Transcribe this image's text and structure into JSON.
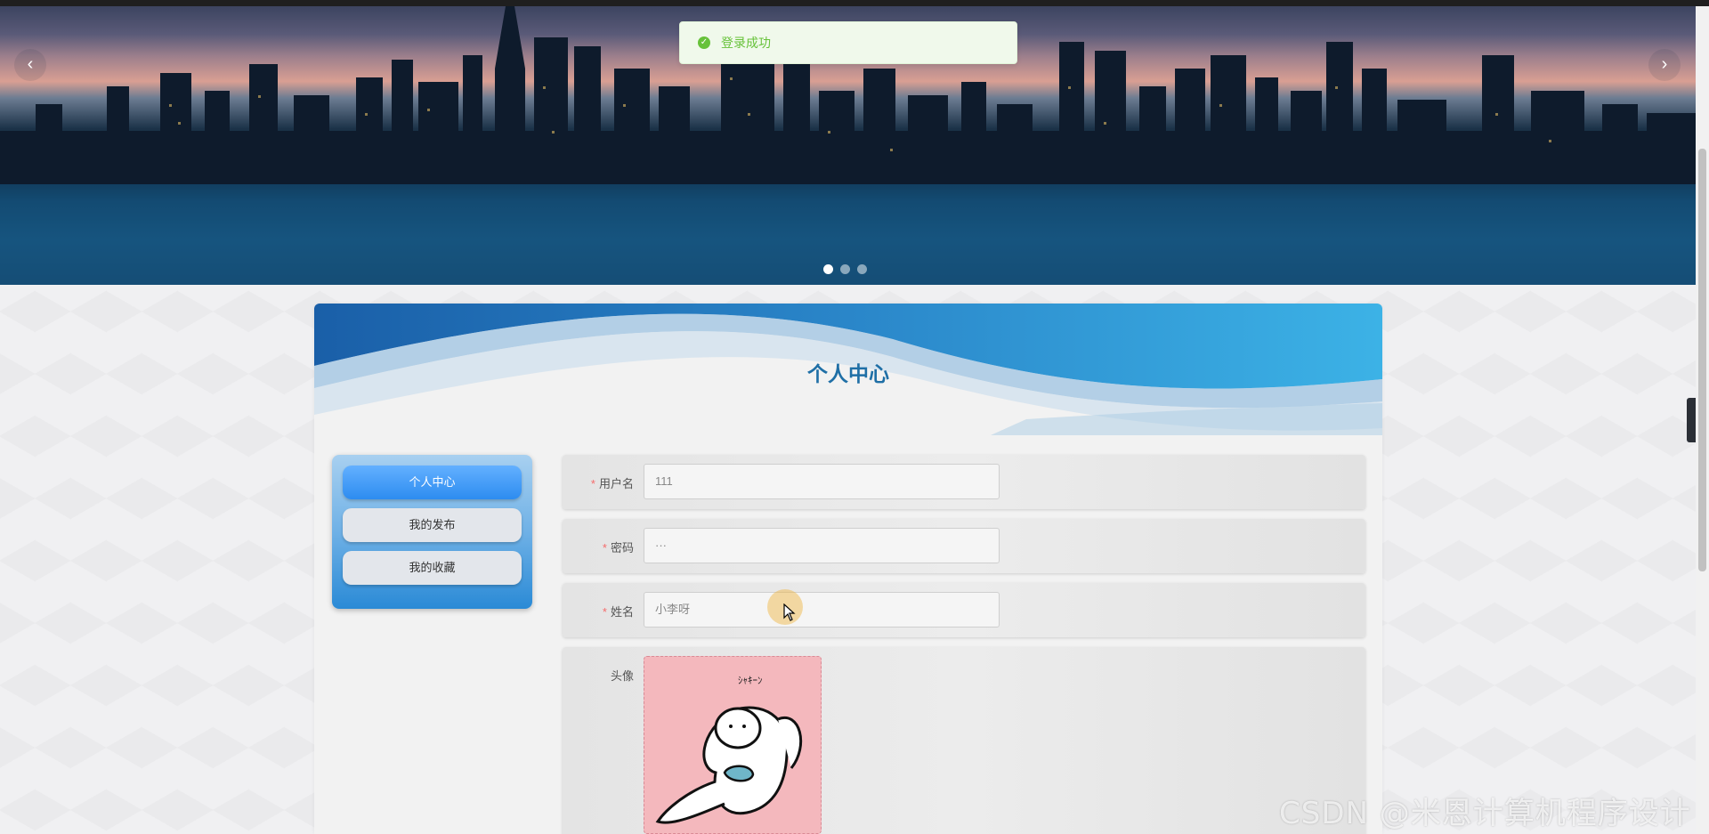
{
  "toast": {
    "message": "登录成功",
    "icon": "check-circle-icon",
    "color": "#67c23a"
  },
  "carousel": {
    "prev_label": "‹",
    "next_label": "›",
    "slide_count": 3,
    "active_index": 0
  },
  "panel": {
    "title": "个人中心"
  },
  "menu": {
    "items": [
      {
        "label": "个人中心",
        "active": true
      },
      {
        "label": "我的发布",
        "active": false
      },
      {
        "label": "我的收藏",
        "active": false
      }
    ]
  },
  "form": {
    "username": {
      "label": "用户名",
      "required": true,
      "value": "111"
    },
    "password": {
      "label": "密码",
      "required": true,
      "value": "···"
    },
    "name": {
      "label": "姓名",
      "required": true,
      "value": "小李呀"
    },
    "avatar": {
      "label": "头像",
      "required": false,
      "caption": "ｼｬｷｰﾝ"
    }
  },
  "side_toggle": {
    "label": "‹"
  },
  "watermark": "CSDN @米恩计算机程序设计",
  "colors": {
    "accent": "#2d8cf0",
    "title": "#1f6fa6",
    "required": "#f56c6c"
  }
}
